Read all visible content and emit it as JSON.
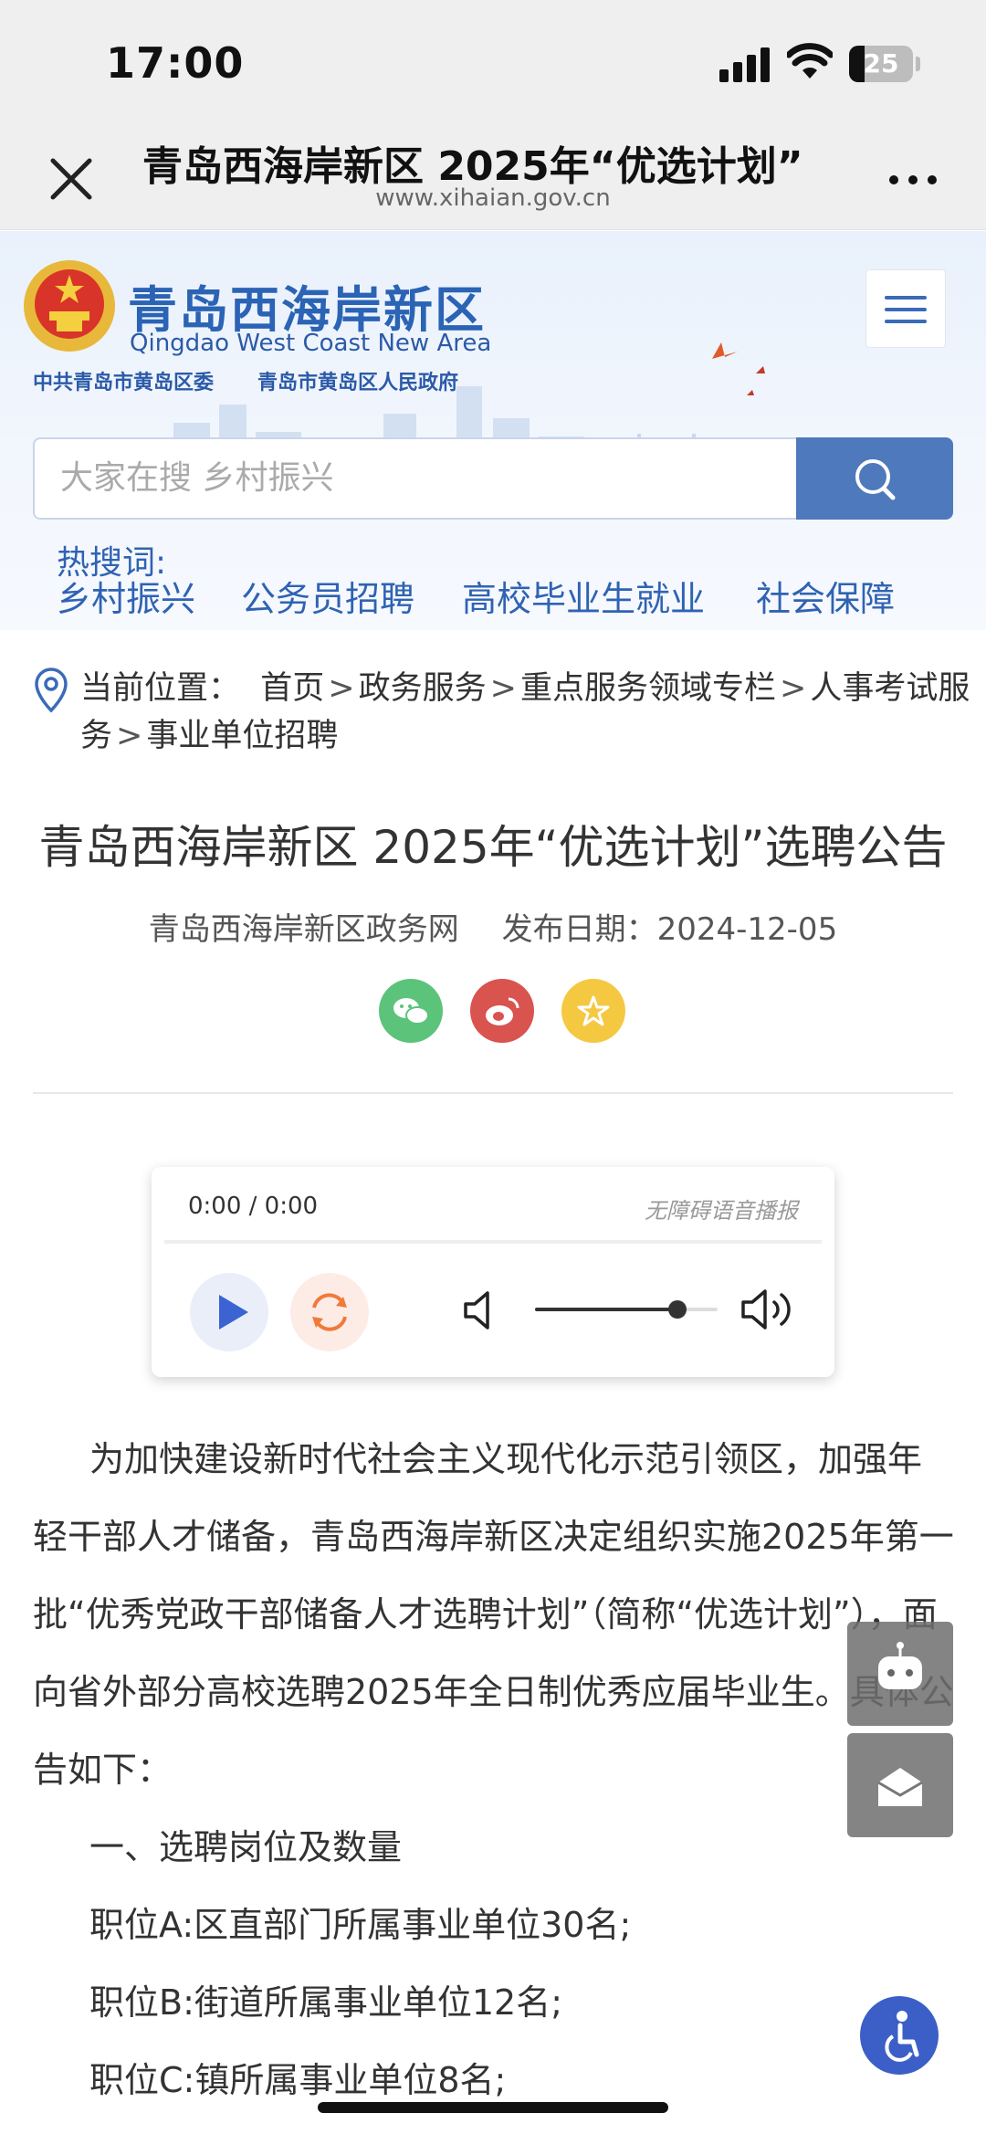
{
  "status_bar": {
    "time": "17:00",
    "battery": "25"
  },
  "browser": {
    "title": "青岛西海岸新区 2025年“优选计划”",
    "url": "www.xihaian.gov.cn"
  },
  "site": {
    "name": "青岛西海岸新区",
    "name_en": "Qingdao West Coast New Area",
    "org_party": "中共青岛市黄岛区委",
    "org_gov": "青岛市黄岛区人民政府"
  },
  "search": {
    "placeholder": "大家在搜 乡村振兴"
  },
  "hot": {
    "label": "热搜词:",
    "items": [
      "乡村振兴",
      "公务员招聘",
      "高校毕业生就业",
      "社会保障"
    ]
  },
  "breadcrumb": {
    "label": "当前位置：",
    "items": [
      "首页",
      "政务服务",
      "重点服务领域专栏",
      "人事考试服务",
      "事业单位招聘"
    ],
    "sep": ">"
  },
  "article": {
    "title": "青岛西海岸新区 2025年“优选计划”选聘公告",
    "source": "青岛西海岸新区政务网",
    "date_label": "发布日期：2024-12-05"
  },
  "share": {
    "wechat": "wechat-icon",
    "weibo": "weibo-icon",
    "favorite": "star-icon"
  },
  "player": {
    "time": "0:00 / 0:00",
    "label": "无障碍语音播报",
    "volume": 0.78
  },
  "body": {
    "para1": "为加快建设新时代社会主义现代化示范引领区，加强年轻干部人才储备，青岛西海岸新区决定组织实施2025年第一批“优秀党政干部储备人才选聘计划”（简称“优选计划”），面向省外部分高校选聘2025年全日制优秀应届毕业生。具体公告如下：",
    "section1": "一、选聘岗位及数量",
    "posA": "职位A:区直部门所属事业单位30名;",
    "posB": "职位B:街道所属事业单位12名;",
    "posC": "职位C:镇所属事业单位8名;"
  },
  "colors": {
    "accent": "#2f63b2",
    "search_btn": "#4f79bd",
    "wechat": "#5cc37a",
    "weibo": "#d9534f",
    "favorite": "#f5c842",
    "accessibility": "#3b5fc7"
  }
}
